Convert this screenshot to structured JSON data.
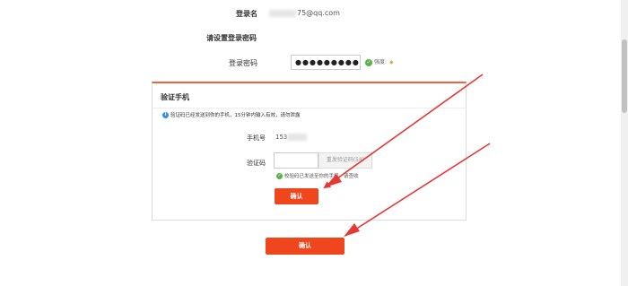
{
  "form": {
    "username_label": "登录名",
    "username_value": "75@qq.com",
    "set_password_heading": "请设置登录密码",
    "password_label": "登录密码",
    "password_value": "●●●●●●●●●",
    "strength_label": "强度:",
    "confirm_label": "确认"
  },
  "modal": {
    "title": "验证手机",
    "info_text": "验证码已经发送到你的手机，15分钟内输入有效，请勿泄露",
    "phone_label": "手机号",
    "phone_value": "153",
    "code_label": "验证码",
    "resend_label": "重发验证码(58)",
    "sent_text": "校验码已发送至你的手机，请查收",
    "confirm_label": "确认"
  },
  "colors": {
    "accent": "#f0461e",
    "modal_border": "#f0643a",
    "success": "#5ab14a",
    "info": "#3a8ee6",
    "arrow": "#e53935"
  },
  "icons": [
    "check-icon",
    "info-icon",
    "arrow-annotation"
  ]
}
